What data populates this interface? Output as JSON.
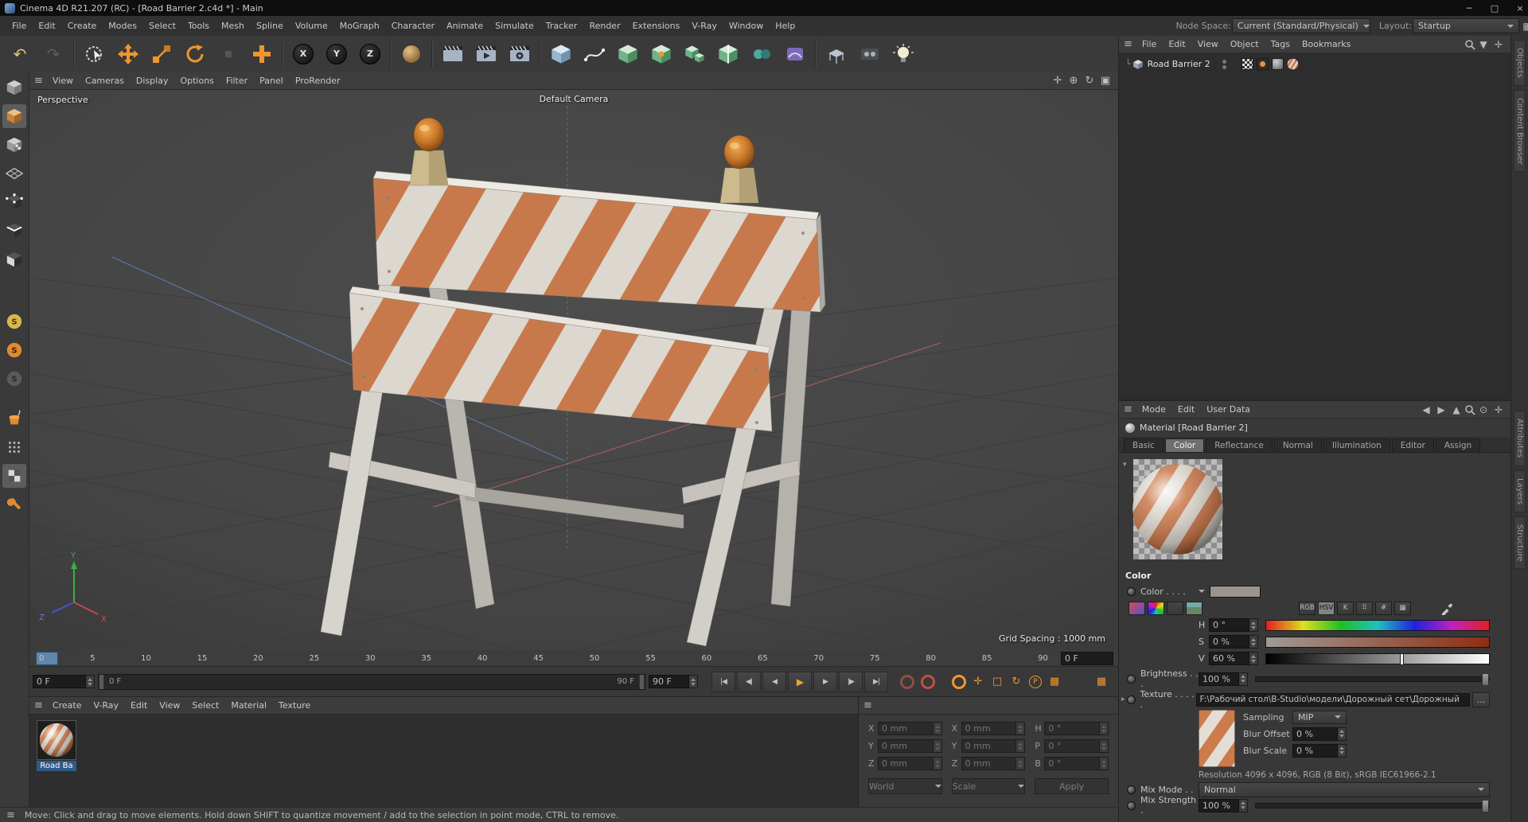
{
  "titlebar": {
    "title": "Cinema 4D R21.207 (RC) - [Road Barrier 2.c4d *] - Main"
  },
  "menubar": {
    "items": [
      "File",
      "Edit",
      "Create",
      "Modes",
      "Select",
      "Tools",
      "Mesh",
      "Spline",
      "Volume",
      "MoGraph",
      "Character",
      "Animate",
      "Simulate",
      "Tracker",
      "Render",
      "Extensions",
      "V-Ray",
      "Window",
      "Help"
    ],
    "node_space_label": "Node Space:",
    "node_space_value": "Current (Standard/Physical)",
    "layout_label": "Layout:",
    "layout_value": "Startup"
  },
  "toolbar": {
    "axis_locks": [
      "X",
      "Y",
      "Z"
    ]
  },
  "palette": {
    "solo_letter": "S"
  },
  "viewport": {
    "menu": [
      "View",
      "Cameras",
      "Display",
      "Options",
      "Filter",
      "Panel",
      "ProRender"
    ],
    "perspective_label": "Perspective",
    "camera_label": "Default Camera",
    "grid_spacing": "Grid Spacing : 1000 mm",
    "axis": {
      "x": "X",
      "y": "Y",
      "z": "Z"
    }
  },
  "timeline": {
    "ticks": [
      "0",
      "5",
      "10",
      "15",
      "20",
      "25",
      "30",
      "35",
      "40",
      "45",
      "50",
      "55",
      "60",
      "65",
      "70",
      "75",
      "80",
      "85",
      "90"
    ],
    "ruler_field": "0 F",
    "start_field": "0 F",
    "slider_start": "0 F",
    "slider_end": "90 F",
    "end_field": "90 F",
    "param_letter": "P"
  },
  "material_manager": {
    "menu": [
      "Create",
      "V-Ray",
      "Edit",
      "View",
      "Select",
      "Material",
      "Texture"
    ],
    "material_name": "Road Ba"
  },
  "coordinates": {
    "position": {
      "x_label": "X",
      "x": "0 mm",
      "y_label": "Y",
      "y": "0 mm",
      "z_label": "Z",
      "z": "0 mm"
    },
    "size": {
      "x_label": "X",
      "x": "0 mm",
      "y_label": "Y",
      "y": "0 mm",
      "z_label": "Z",
      "z": "0 mm"
    },
    "rotation": {
      "h_label": "H",
      "h": "0 °",
      "p_label": "P",
      "p": "0 °",
      "b_label": "B",
      "b": "0 °"
    },
    "world_button": "World",
    "scale_button": "Scale",
    "apply_button": "Apply"
  },
  "object_manager": {
    "menu": [
      "File",
      "Edit",
      "View",
      "Object",
      "Tags",
      "Bookmarks"
    ],
    "object_name": "Road Barrier 2"
  },
  "attributes": {
    "menu": [
      "Mode",
      "Edit",
      "User Data"
    ],
    "title": "Material [Road Barrier 2]",
    "tabs": [
      "Basic",
      "Color",
      "Reflectance",
      "Normal",
      "Illumination",
      "Editor",
      "Assign"
    ],
    "section_title": "Color",
    "color_label": "Color . . . .",
    "mode_buttons": [
      "RGB",
      "HSV",
      "K",
      "#"
    ],
    "h_label": "H",
    "h_value": "0 °",
    "s_label": "S",
    "s_value": "0 %",
    "v_label": "V",
    "v_value": "60 %",
    "brightness_label": "Brightness . . .",
    "brightness_value": "100 %",
    "texture_label": "Texture . . . . .",
    "texture_path": "F:\\Рабочий стол\\B-Studio\\модели\\Дорожный сет\\Дорожный",
    "browse_button": "...",
    "sampling_label": "Sampling",
    "sampling_value": "MIP",
    "blur_offset_label": "Blur Offset",
    "blur_offset_value": "0 %",
    "blur_scale_label": "Blur Scale",
    "blur_scale_value": "0 %",
    "resolution": "Resolution 4096 x 4096, RGB (8 Bit), sRGB IEC61966-2.1",
    "mix_mode_label": "Mix Mode . .",
    "mix_mode_value": "Normal",
    "mix_strength_label": "Mix Strength .",
    "mix_strength_value": "100 %"
  },
  "right_tabs": {
    "top": [
      "Objects",
      "Content Browser"
    ],
    "bottom": [
      "Attributes",
      "Layers",
      "Structure"
    ]
  },
  "status_bar": {
    "text": "Move: Click and drag to move elements. Hold down SHIFT to quantize movement / add to the selection in point mode, CTRL to remove."
  }
}
